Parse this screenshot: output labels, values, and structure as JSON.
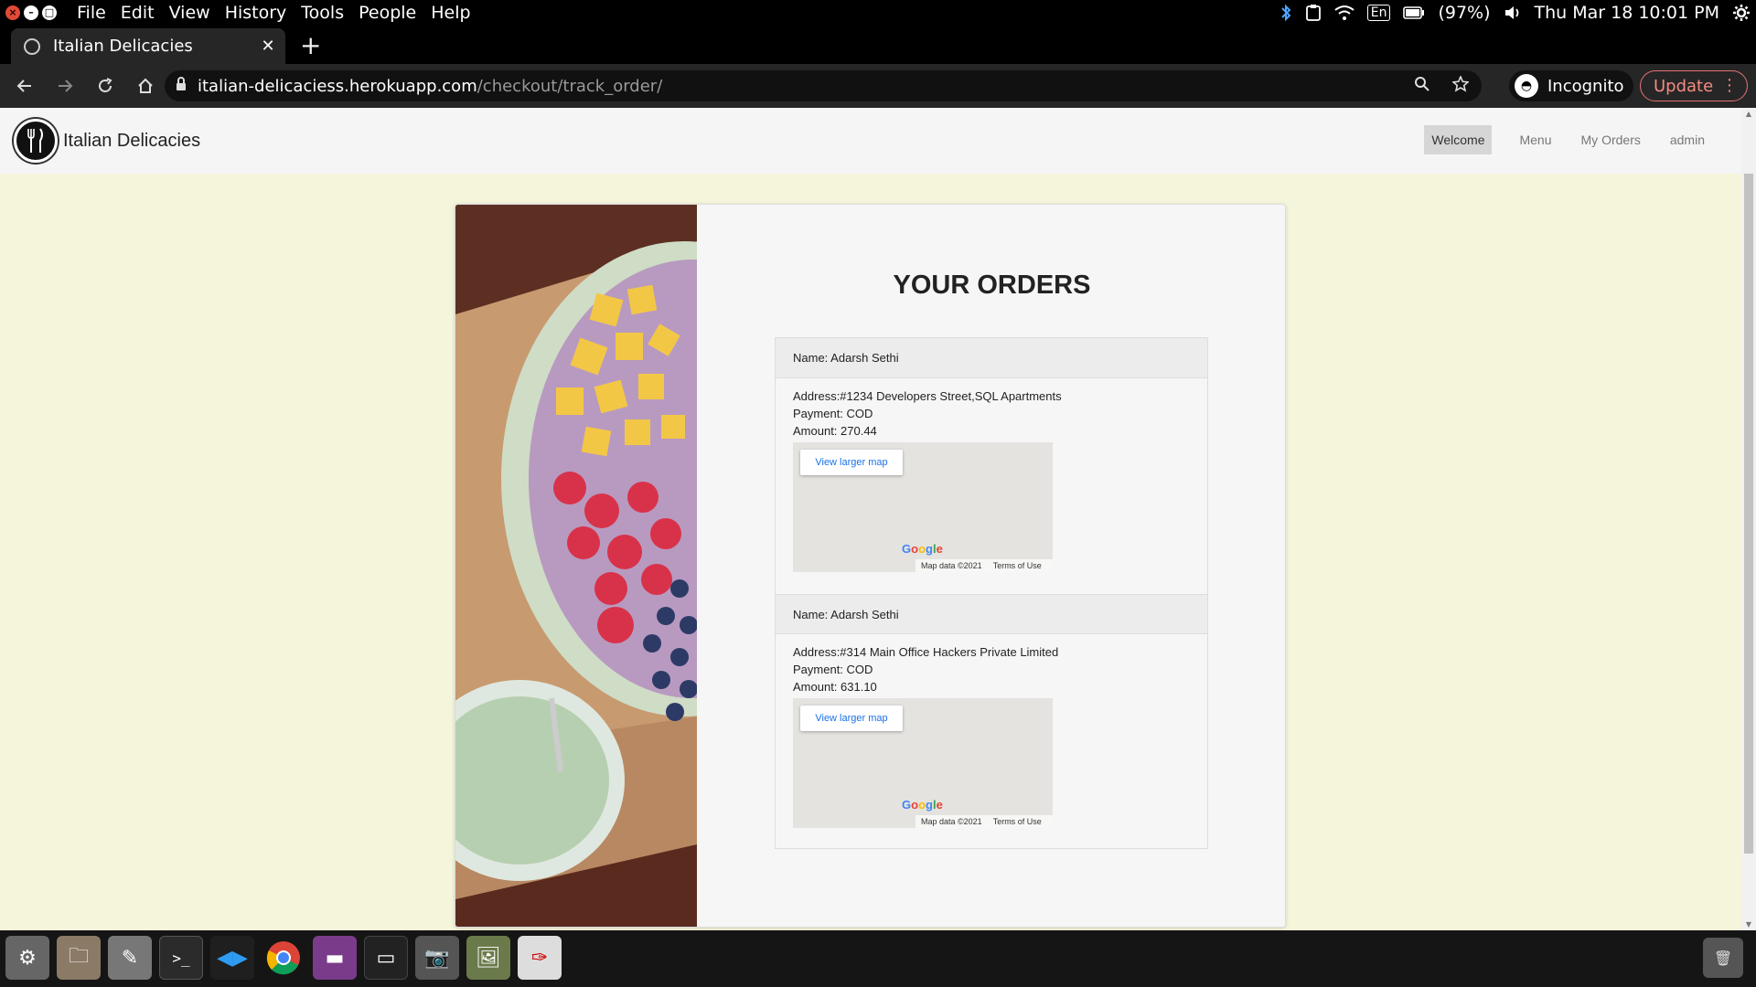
{
  "os": {
    "menu": [
      "File",
      "Edit",
      "View",
      "History",
      "Tools",
      "People",
      "Help"
    ],
    "keyboard": "En",
    "battery": "(97%)",
    "clock": "Thu Mar 18 10:01 PM"
  },
  "browser": {
    "tab_title": "Italian Delicacies",
    "url_host": "italian-delicaciess.herokuapp.com",
    "url_path": "/checkout/track_order/",
    "incognito_label": "Incognito",
    "update_label": "Update"
  },
  "site": {
    "brand": "Italian Delicacies",
    "nav": [
      "Welcome",
      "Menu",
      "My Orders",
      "admin"
    ]
  },
  "main": {
    "title": "YOUR ORDERS",
    "orders": [
      {
        "name": "Name: Adarsh Sethi",
        "address": "Address:#1234 Developers Street,SQL Apartments",
        "payment": "Payment: COD",
        "amount": "Amount: 270.44",
        "map_button": "View larger map",
        "map_data": "Map data ©2021",
        "map_terms": "Terms of Use"
      },
      {
        "name": "Name: Adarsh Sethi",
        "address": "Address:#314 Main Office Hackers Private Limited",
        "payment": "Payment: COD",
        "amount": "Amount: 631.10",
        "map_button": "View larger map",
        "map_data": "Map data ©2021",
        "map_terms": "Terms of Use"
      }
    ]
  },
  "colors": {
    "page_bg": "#f5f5dc",
    "update_accent": "#f28b82",
    "map_link": "#1a73e8"
  }
}
